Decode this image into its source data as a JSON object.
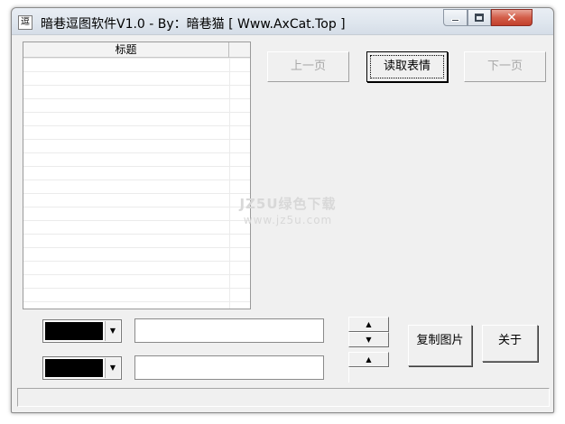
{
  "window": {
    "title": "暗巷逗图软件V1.0 - By：暗巷猫 [ Www.AxCat.Top ]",
    "app_icon_glyph": "逗",
    "controls": {
      "minimize": "minimize-icon",
      "maximize": "maximize-icon",
      "close": "close-icon"
    }
  },
  "list": {
    "header_title": "标题",
    "rows": []
  },
  "buttons": {
    "prev_page": "上一页",
    "read_emoticons": "读取表情",
    "next_page": "下一页",
    "copy_image": "复制图片",
    "about": "关于"
  },
  "color_pickers": [
    {
      "selected_color": "#000000"
    },
    {
      "selected_color": "#000000"
    }
  ],
  "text_fields": [
    {
      "value": ""
    },
    {
      "value": ""
    }
  ],
  "watermark": {
    "line1": "JZ5U绿色下载",
    "line2": "www.jz5u.com"
  },
  "status": ""
}
